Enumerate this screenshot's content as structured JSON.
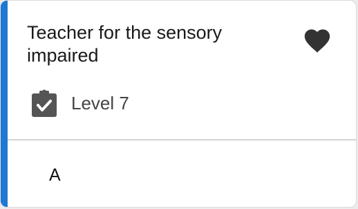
{
  "card": {
    "title": "Teacher for the sensory impaired",
    "accent_color": "#1f78d1",
    "favorite_icon": "heart-icon",
    "meta": {
      "icon": "clipboard-check-icon",
      "label": "Level 7"
    },
    "footer": {
      "text": "A"
    }
  }
}
